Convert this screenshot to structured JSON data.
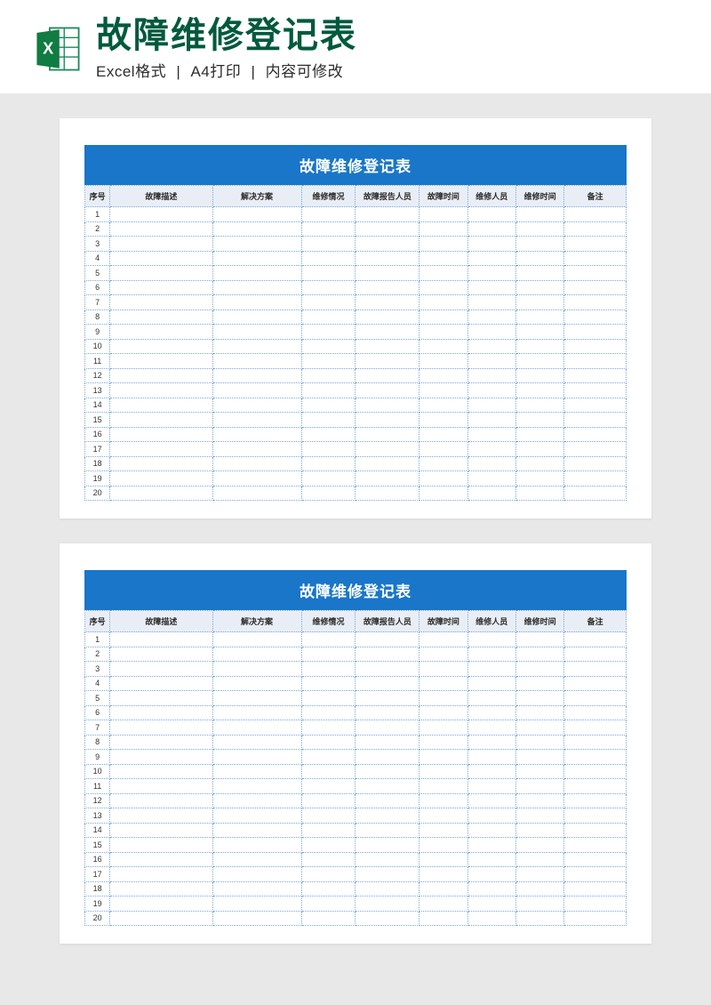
{
  "header": {
    "main_title": "故障维修登记表",
    "sub_parts": [
      "Excel格式",
      "A4打印",
      "内容可修改"
    ]
  },
  "sheet": {
    "title": "故障维修登记表",
    "columns": [
      "序号",
      "故障描述",
      "解决方案",
      "维修情况",
      "故障报告人员",
      "故障时间",
      "维修人员",
      "维修时间",
      "备注"
    ],
    "rows": [
      1,
      2,
      3,
      4,
      5,
      6,
      7,
      8,
      9,
      10,
      11,
      12,
      13,
      14,
      15,
      16,
      17,
      18,
      19,
      20
    ]
  }
}
